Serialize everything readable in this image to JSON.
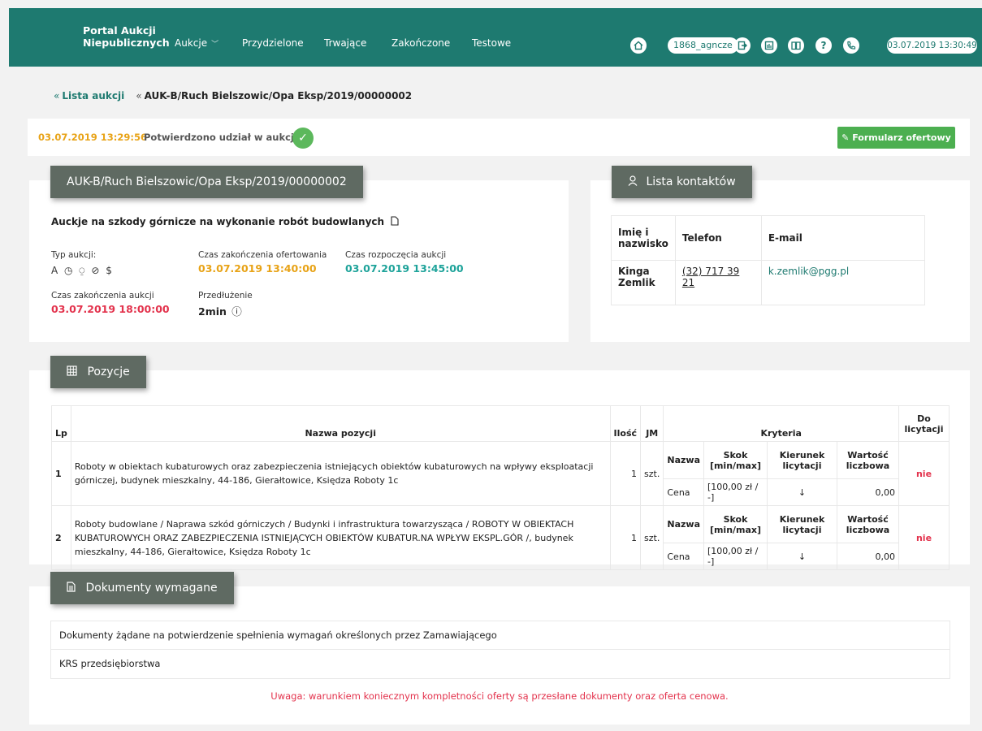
{
  "header": {
    "brand": [
      "Portal Aukcji",
      "Niepublicznych"
    ],
    "nav": [
      {
        "label": "Aukcje",
        "caret": "﹀"
      },
      {
        "label": "Przydzielone"
      },
      {
        "label": "Trwające"
      },
      {
        "label": "Zakończone"
      },
      {
        "label": "Testowe"
      }
    ],
    "icons": [
      "home-icon",
      "logout-icon",
      "calculator-icon",
      "book-icon",
      "help-icon",
      "phone-icon"
    ],
    "user": "1868_agncze",
    "clock": "03.07.2019 13:30:49"
  },
  "breadcrumb": {
    "list": "Lista aukcji",
    "current": "AUK-B/Ruch Bielszowic/Opa Eksp/2019/00000002",
    "chevron": "«"
  },
  "status": {
    "time": "03.07.2019 13:29:56",
    "text": "Potwierdzono udział w aukcji",
    "check": "✓",
    "form_button": "Formularz ofertowy",
    "form_icon": "✎"
  },
  "auction": {
    "tab_title": "AUK-B/Ruch Bielszowic/Opa Eksp/2019/00000002",
    "description": "Auckje na szkody górnicze na wykonanie robót budowlanych",
    "type_label": "Typ aukcji:",
    "type_icons": "A ◷ ⍜ ⊘ $",
    "offer_end_label": "Czas zakończenia ofertowania",
    "offer_end_value": "03.07.2019 13:40:00",
    "start_label": "Czas rozpoczęcia aukcji",
    "start_value": "03.07.2019 13:45:00",
    "end_label": "Czas zakończenia aukcji",
    "end_value": "03.07.2019 18:00:00",
    "ext_label": "Przedłużenie",
    "ext_value": "2min",
    "ext_icon": "ⓘ"
  },
  "contacts": {
    "tab_title": "Lista kontaktów",
    "headers": [
      "Imię i nazwisko",
      "Telefon",
      "E-mail"
    ],
    "rows": [
      {
        "name": "Kinga Zemlik",
        "phone": "(32) 717 39 21",
        "email": "k.zemlik@pgg.pl"
      }
    ]
  },
  "positions": {
    "tab_title": "Pozycje",
    "headers": {
      "lp": "Lp",
      "name": "Nazwa pozycji",
      "qty": "Ilość",
      "unit": "JM",
      "criteria": "Kryteria",
      "bid": "Do licytacji"
    },
    "crit_headers": [
      "Nazwa",
      "Skok [min/max]",
      "Kierunek licytacji",
      "Wartość liczbowa"
    ],
    "rows": [
      {
        "lp": "1",
        "name": "Roboty w obiektach kubaturowych oraz zabezpieczenia istniejących obiektów kubaturowych na wpływy eksploatacji górniczej, budynek mieszkalny, 44-186, Gierałtowice, Księdza Roboty 1c",
        "qty": "1",
        "unit": "szt.",
        "crit": {
          "name": "Cena",
          "step": "[100,00 zł / -]",
          "dir": "↓",
          "value": "0,00"
        },
        "bid": "nie"
      },
      {
        "lp": "2",
        "name": "Roboty budowlane / Naprawa szkód górniczych / Budynki i infrastruktura towarzysząca / ROBOTY W OBIEKTACH KUBATUROWYCH ORAZ ZABEZPIECZENIA ISTNIEJĄCYCH OBIEKTÓW KUBATUR.NA WPŁYW EKSPL.GÓR /, budynek mieszkalny, 44-186, Gierałtowice, Księdza Roboty 1c",
        "qty": "1",
        "unit": "szt.",
        "crit": {
          "name": "Cena",
          "step": "[100,00 zł / -]",
          "dir": "↓",
          "value": "0,00"
        },
        "bid": "nie"
      }
    ]
  },
  "documents": {
    "tab_title": "Dokumenty wymagane",
    "items": [
      "Dokumenty żądane na potwierdzenie spełnienia wymagań określonych przez Zamawiającego",
      "KRS przedsiębiorstwa"
    ],
    "warning": "Uwaga: warunkiem koniecznym kompletności oferty są przesłane dokumenty oraz oferta cenowa."
  }
}
